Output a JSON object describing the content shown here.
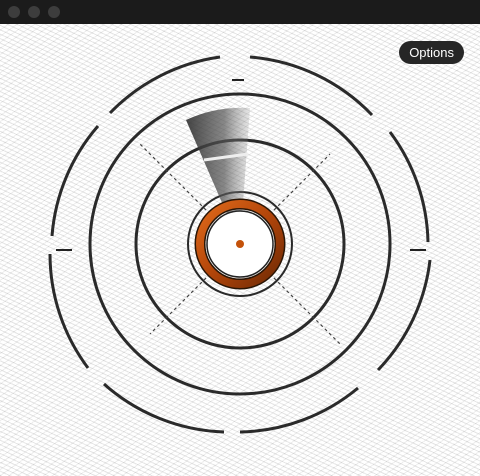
{
  "window": {
    "title": "",
    "controls": [
      "close",
      "minimize",
      "zoom"
    ]
  },
  "toolbar": {
    "options_label": "Options"
  },
  "radar": {
    "accent_color": "#c4520a",
    "ring_color": "#2a2a2a",
    "sweep_color": "#3a3a3a",
    "center_marker_color": "#c4520a"
  }
}
